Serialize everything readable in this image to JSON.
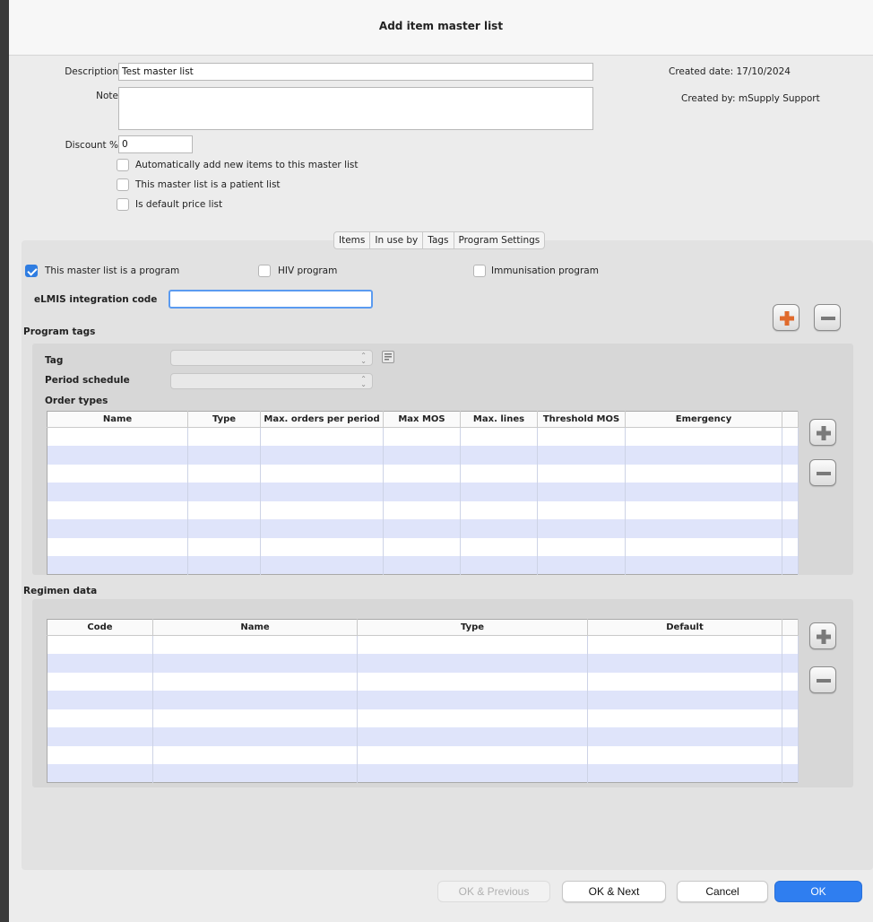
{
  "window": {
    "title": "Add item master list"
  },
  "form": {
    "description_label": "Description",
    "description_value": "Test master list",
    "note_label": "Note",
    "note_value": "",
    "discount_label": "Discount %",
    "discount_value": "0",
    "created_date_label": "Created date:",
    "created_date_value": "17/10/2024",
    "created_by_label": "Created by:",
    "created_by_value": "mSupply Support",
    "checkboxes": [
      {
        "label": "Automatically add new items to this master list",
        "checked": false
      },
      {
        "label": "This master list is a patient list",
        "checked": false
      },
      {
        "label": "Is default price list",
        "checked": false
      }
    ]
  },
  "tabs": [
    {
      "label": "Items"
    },
    {
      "label": "In use by"
    },
    {
      "label": "Tags"
    },
    {
      "label": "Program Settings",
      "active": true
    }
  ],
  "program": {
    "is_program_label": "This master list is a program",
    "is_program_checked": true,
    "hiv_label": "HIV program",
    "hiv_checked": false,
    "immunisation_label": "Immunisation program",
    "immunisation_checked": false,
    "elmis_label": "eLMIS integration code",
    "elmis_value": "",
    "program_tags_label": "Program tags",
    "tag_label": "Tag",
    "period_schedule_label": "Period schedule",
    "order_types_label": "Order types"
  },
  "order_types_table": {
    "columns": [
      "Name",
      "Type",
      "Max. orders per period",
      "Max MOS",
      "Max. lines",
      "Threshold MOS",
      "Emergency"
    ],
    "rows": [
      [
        "",
        "",
        "",
        "",
        "",
        "",
        ""
      ],
      [
        "",
        "",
        "",
        "",
        "",
        "",
        ""
      ],
      [
        "",
        "",
        "",
        "",
        "",
        "",
        ""
      ],
      [
        "",
        "",
        "",
        "",
        "",
        "",
        ""
      ],
      [
        "",
        "",
        "",
        "",
        "",
        "",
        ""
      ],
      [
        "",
        "",
        "",
        "",
        "",
        "",
        ""
      ],
      [
        "",
        "",
        "",
        "",
        "",
        "",
        ""
      ],
      [
        "",
        "",
        "",
        "",
        "",
        "",
        ""
      ]
    ]
  },
  "regimen": {
    "label": "Regimen data",
    "columns": [
      "Code",
      "Name",
      "Type",
      "Default"
    ],
    "rows": [
      [
        "",
        "",
        "",
        ""
      ],
      [
        "",
        "",
        "",
        ""
      ],
      [
        "",
        "",
        "",
        ""
      ],
      [
        "",
        "",
        "",
        ""
      ],
      [
        "",
        "",
        "",
        ""
      ],
      [
        "",
        "",
        "",
        ""
      ],
      [
        "",
        "",
        "",
        ""
      ],
      [
        "",
        "",
        "",
        ""
      ]
    ]
  },
  "footer": {
    "ok_previous": "OK & Previous",
    "ok_next": "OK & Next",
    "cancel": "Cancel",
    "ok": "OK"
  },
  "colors": {
    "accent": "#2f7de1",
    "add_tag_icon": "#e06a2c",
    "row_alt": "#dfe4fa"
  },
  "icons": {
    "add_program_tag": "plus-orange-icon",
    "remove_program_tag": "minus-icon",
    "add_order_type": "plus-icon",
    "remove_order_type": "minus-icon",
    "add_regimen": "plus-icon",
    "remove_regimen": "minus-icon",
    "tag_picker": "list-picker-icon"
  }
}
